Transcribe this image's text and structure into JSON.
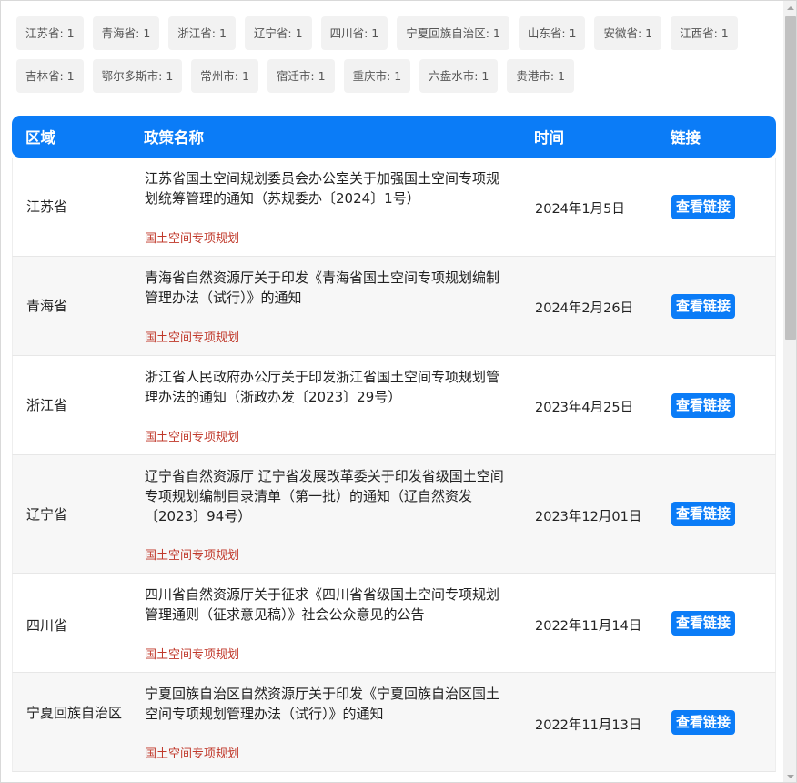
{
  "tags": [
    "江苏省: 1",
    "青海省: 1",
    "浙江省: 1",
    "辽宁省: 1",
    "四川省: 1",
    "宁夏回族自治区: 1",
    "山东省: 1",
    "安徽省: 1",
    "江西省: 1",
    "吉林省: 1",
    "鄂尔多斯市: 1",
    "常州市: 1",
    "宿迁市: 1",
    "重庆市: 1",
    "六盘水市: 1",
    "贵港市: 1"
  ],
  "table": {
    "headers": {
      "region": "区域",
      "title": "政策名称",
      "date": "时间",
      "link": "链接"
    },
    "rows": [
      {
        "region": "江苏省",
        "title": "江苏省国土空间规划委员会办公室关于加强国土空间专项规划统筹管理的通知（苏规委办〔2024〕1号）",
        "category": "国土空间专项规划",
        "date": "2024年1月5日",
        "link": "查看链接"
      },
      {
        "region": "青海省",
        "title": "青海省自然资源厅关于印发《青海省国土空间专项规划编制管理办法（试行）》的通知",
        "category": "国土空间专项规划",
        "date": "2024年2月26日",
        "link": "查看链接"
      },
      {
        "region": "浙江省",
        "title": "浙江省人民政府办公厅关于印发浙江省国土空间专项规划管理办法的通知（浙政办发〔2023〕29号）",
        "category": "国土空间专项规划",
        "date": "2023年4月25日",
        "link": "查看链接"
      },
      {
        "region": "辽宁省",
        "title": "辽宁省自然资源厅 辽宁省发展改革委关于印发省级国土空间专项规划编制目录清单（第一批）的通知（辽自然资发〔2023〕94号）",
        "category": "国土空间专项规划",
        "date": "2023年12月01日",
        "link": "查看链接"
      },
      {
        "region": "四川省",
        "title": "四川省自然资源厅关于征求《四川省省级国土空间专项规划管理通则（征求意见稿）》社会公众意见的公告",
        "category": "国土空间专项规划",
        "date": "2022年11月14日",
        "link": "查看链接"
      },
      {
        "region": "宁夏回族自治区",
        "title": "宁夏回族自治区自然资源厅关于印发《宁夏回族自治区国土空间专项规划管理办法（试行）》的通知",
        "category": "国土空间专项规划",
        "date": "2022年11月13日",
        "link": "查看链接"
      }
    ]
  }
}
